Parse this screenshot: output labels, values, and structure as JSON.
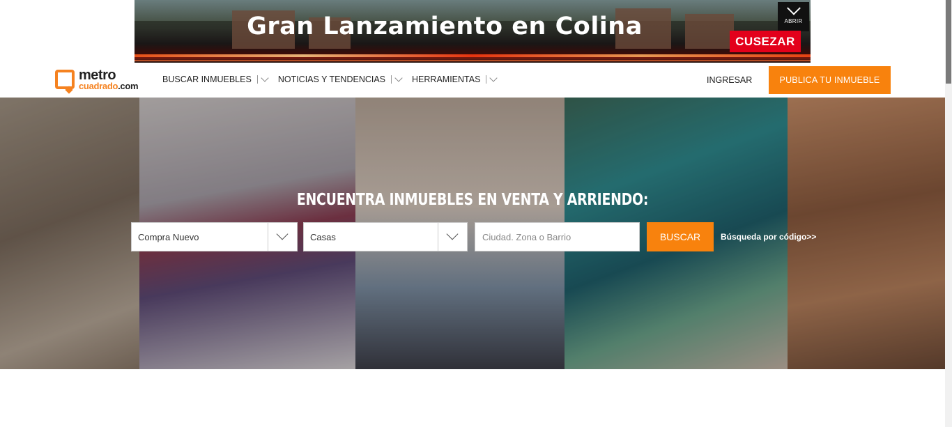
{
  "ad": {
    "title": "Gran Lanzamiento en Colina",
    "open_label": "ABRIR",
    "brand": "CUSEZAR",
    "brand_color": "#e3001b"
  },
  "header": {
    "logo_top": "metro",
    "logo_bottom": "cuadrado",
    "logo_domain": ".com",
    "nav": [
      {
        "label": "BUSCAR INMUEBLES"
      },
      {
        "label": "NOTICIAS Y TENDENCIAS"
      },
      {
        "label": "HERRAMIENTAS"
      }
    ],
    "login_label": "INGRESAR",
    "publish_label": "PUBLICA TU INMUEBLE",
    "accent_color": "#f8820d"
  },
  "hero": {
    "title": "ENCUENTRA INMUEBLES EN VENTA Y ARRIENDO:",
    "operation_select": "Compra Nuevo",
    "type_select": "Casas",
    "location_placeholder": "Ciudad. Zona o Barrio",
    "search_label": "BUSCAR",
    "code_search_label": "Búsqueda por código>>"
  },
  "icons": [
    "chevron-down-icon",
    "logo-icon"
  ]
}
